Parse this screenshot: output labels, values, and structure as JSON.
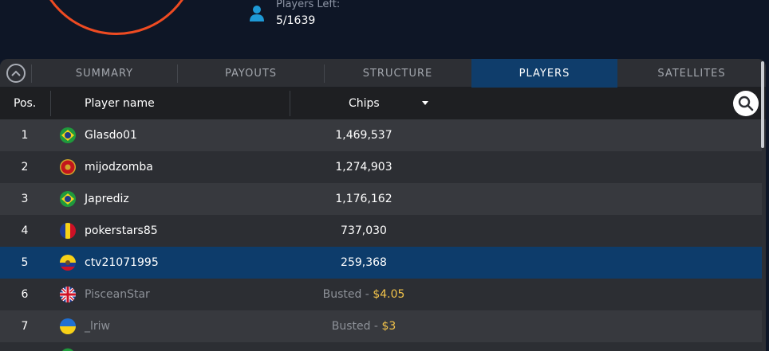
{
  "players_left": {
    "label": "Players Left:",
    "value": "5/1639"
  },
  "tabs": [
    {
      "label": "SUMMARY",
      "active": false
    },
    {
      "label": "PAYOUTS",
      "active": false
    },
    {
      "label": "STRUCTURE",
      "active": false
    },
    {
      "label": "PLAYERS",
      "active": true
    },
    {
      "label": "SATELLITES",
      "active": false
    }
  ],
  "table": {
    "headers": {
      "pos": "Pos.",
      "player": "Player name",
      "chips": "Chips"
    },
    "rows": [
      {
        "pos": "1",
        "flag": "brazil-flag-icon",
        "name": "Glasdo01",
        "chips": "1,469,537"
      },
      {
        "pos": "2",
        "flag": "montenegro-flag-icon",
        "name": "mijodzomba",
        "chips": "1,274,903"
      },
      {
        "pos": "3",
        "flag": "brazil-flag-icon",
        "name": "Japrediz",
        "chips": "1,176,162"
      },
      {
        "pos": "4",
        "flag": "romania-flag-icon",
        "name": "pokerstars85",
        "chips": "737,030"
      },
      {
        "pos": "5",
        "flag": "ecuador-flag-icon",
        "name": "ctv21071995",
        "chips": "259,368"
      },
      {
        "pos": "6",
        "flag": "uk-flag-icon",
        "name": "PisceanStar",
        "busted_label": "Busted - ",
        "busted_amount": "$4.05"
      },
      {
        "pos": "7",
        "flag": "ukraine-flag-icon",
        "name": "_lriw",
        "busted_label": "Busted - ",
        "busted_amount": "$3"
      }
    ]
  },
  "colors": {
    "accent_ring": "#ee4b22",
    "active_tab": "#0f3d6b",
    "highlight_row": "#0d3c6b",
    "payout_amount": "#f1c24a",
    "user_icon": "#1e9ad6"
  }
}
